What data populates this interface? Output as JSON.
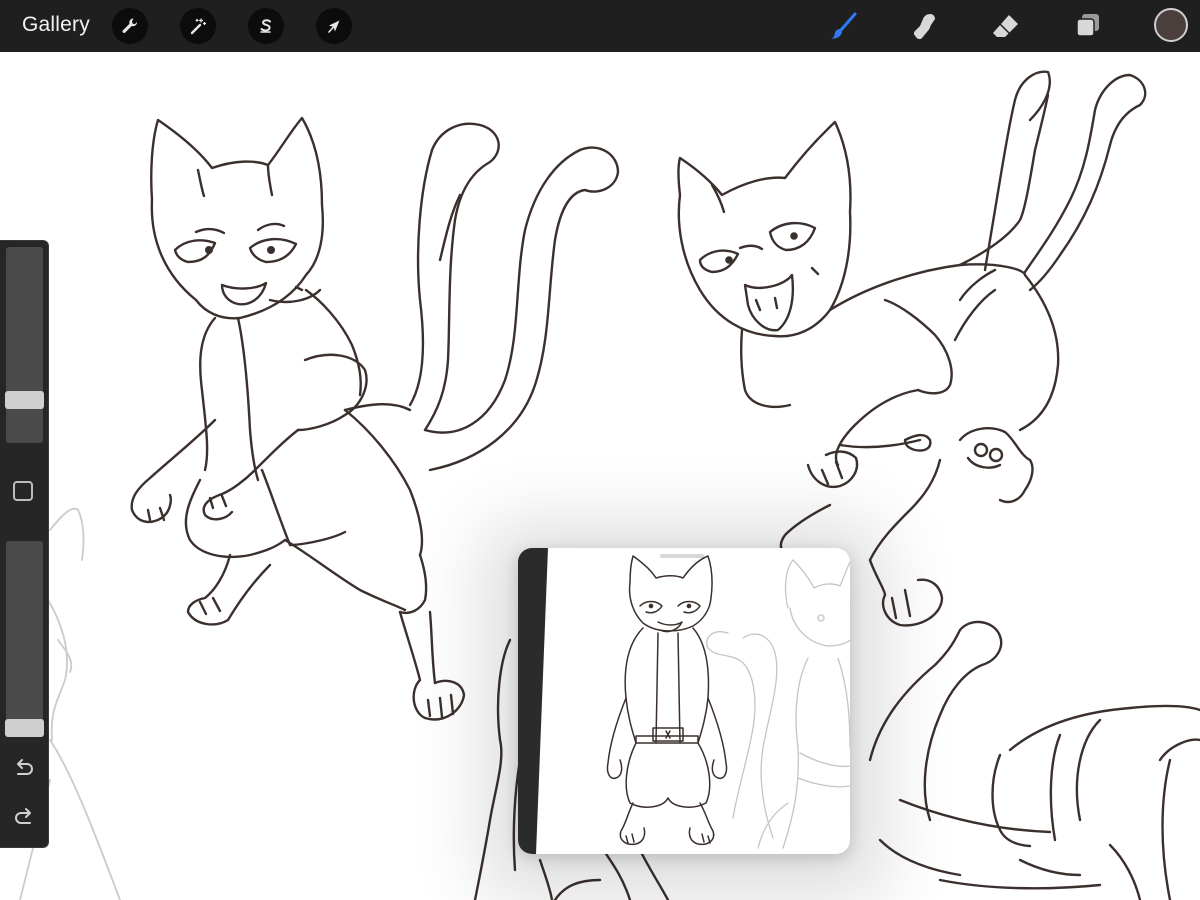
{
  "topbar": {
    "gallery_label": "Gallery",
    "left_tools": [
      {
        "name": "actions",
        "icon": "wrench-icon"
      },
      {
        "name": "adjustments",
        "icon": "magic-wand-icon"
      },
      {
        "name": "selection",
        "icon": "selection-s-icon"
      },
      {
        "name": "transform",
        "icon": "arrow-cursor-icon"
      }
    ],
    "right_tools": [
      {
        "name": "brush",
        "icon": "brush-icon",
        "active": true
      },
      {
        "name": "smudge",
        "icon": "smudge-finger-icon",
        "active": false
      },
      {
        "name": "eraser",
        "icon": "eraser-icon",
        "active": false
      },
      {
        "name": "layers",
        "icon": "layers-icon",
        "active": false
      }
    ],
    "current_color": "#4a3f3c"
  },
  "colors": {
    "topbar_bg": "#1f1f1f",
    "active_tool": "#2f7bf5",
    "inactive_tool": "#d8d8d8",
    "line_art": "#3b302d",
    "sketch_faint": "#cfc9c8",
    "sidebar_bg": "#262626"
  },
  "sidebar": {
    "brush_size_level": 0.28,
    "opacity_level": 0.0,
    "modify_icon": "square-modify-icon",
    "undo_icon": "undo-icon",
    "redo_icon": "redo-icon"
  },
  "reference_window": {
    "content": "cat-character-reference",
    "handle_icon": "drag-handle-icon"
  }
}
